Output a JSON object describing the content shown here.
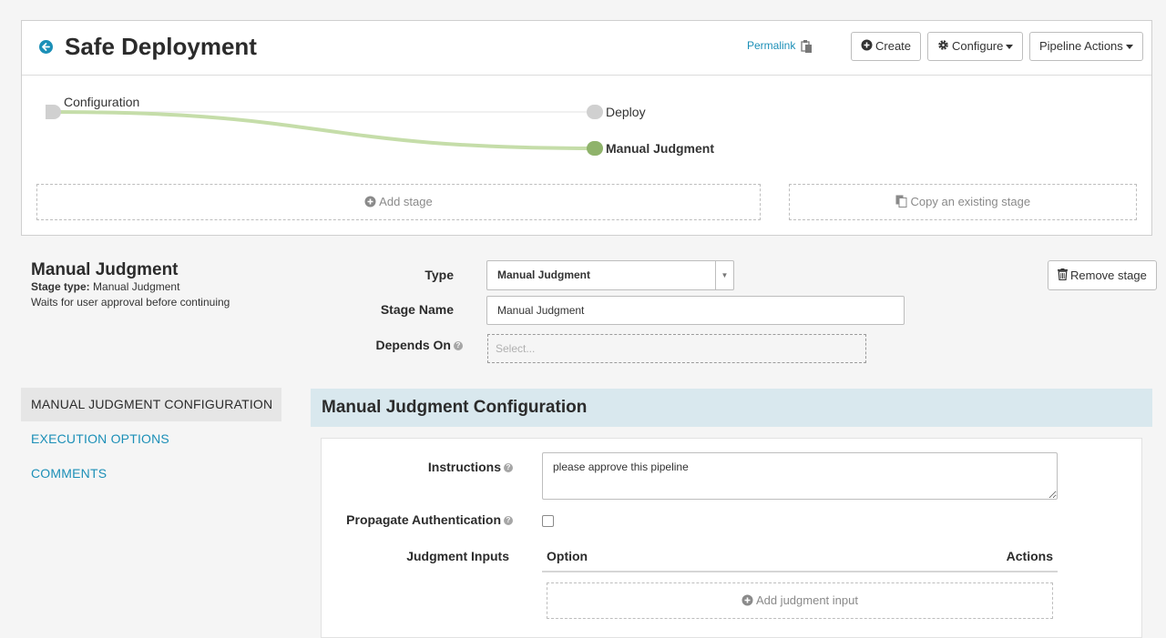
{
  "header": {
    "title": "Safe Deployment",
    "permalink_label": "Permalink",
    "create_label": "Create",
    "configure_label": "Configure",
    "pipeline_actions_label": "Pipeline Actions"
  },
  "graph": {
    "nodes": {
      "configuration": "Configuration",
      "deploy": "Deploy",
      "manual_judgment": "Manual Judgment"
    },
    "add_stage_label": "Add stage",
    "copy_stage_label": "Copy an existing stage",
    "colors": {
      "active": "#8fb36b",
      "inactive": "#d0d0d0",
      "edge_active": "#c5dda9"
    }
  },
  "stage": {
    "title": "Manual Judgment",
    "type_prefix": "Stage type:",
    "type_value": "Manual Judgment",
    "description": "Waits for user approval before continuing",
    "form": {
      "type_label": "Type",
      "type_value": "Manual Judgment",
      "name_label": "Stage Name",
      "name_value": "Manual Judgment",
      "depends_label": "Depends On",
      "depends_placeholder": "Select..."
    },
    "remove_label": "Remove stage"
  },
  "sidenav": {
    "items": [
      {
        "label": "MANUAL JUDGMENT CONFIGURATION",
        "active": true
      },
      {
        "label": "EXECUTION OPTIONS",
        "active": false
      },
      {
        "label": "COMMENTS",
        "active": false
      }
    ]
  },
  "config": {
    "heading": "Manual Judgment Configuration",
    "instructions_label": "Instructions",
    "instructions_value": "please approve this pipeline",
    "propagate_label": "Propagate Authentication",
    "propagate_checked": false,
    "judgment_inputs_label": "Judgment Inputs",
    "option_header": "Option",
    "actions_header": "Actions",
    "add_input_label": "Add judgment input"
  },
  "theme": {
    "accent": "#1b8fb7",
    "header_bg": "#d9e8ee"
  }
}
